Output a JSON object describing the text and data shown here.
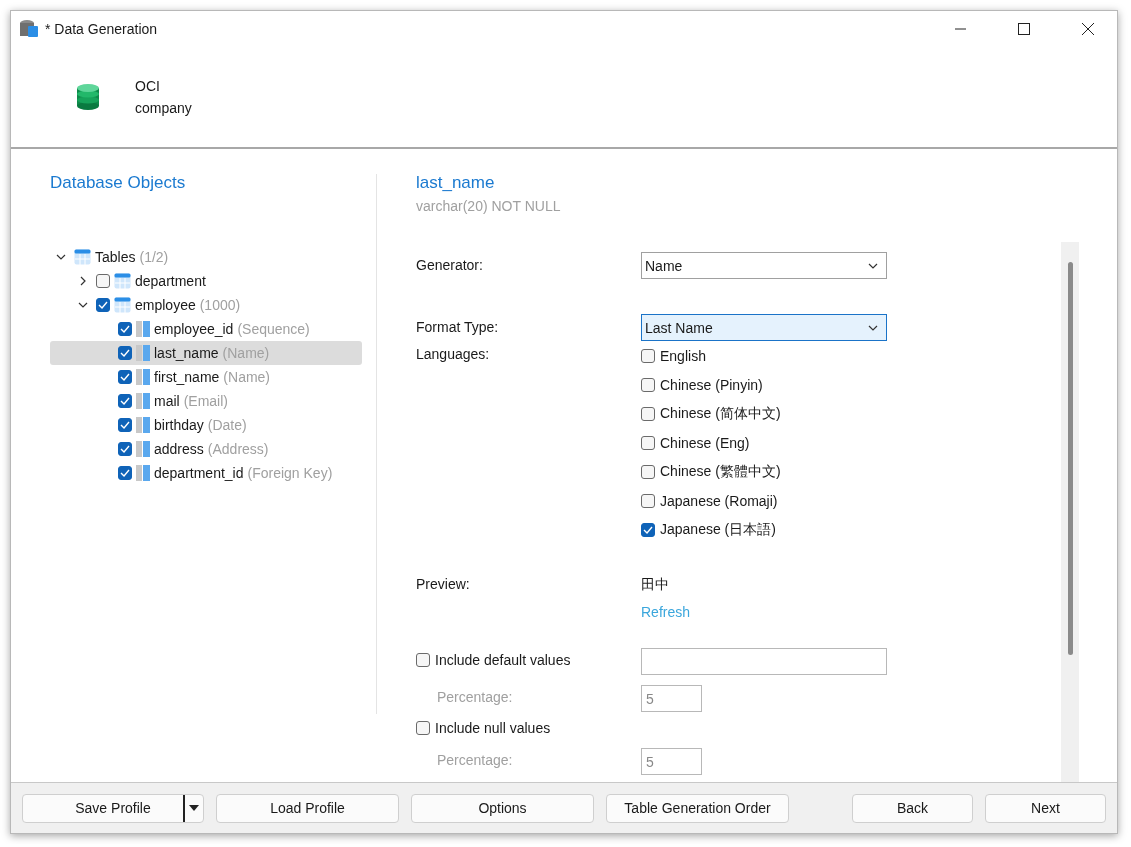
{
  "window": {
    "title": "* Data Generation"
  },
  "connection": {
    "name": "OCI",
    "database": "company"
  },
  "objects_panel": {
    "title": "Database Objects",
    "tree": [
      {
        "kind": "group",
        "label": "Tables",
        "note": "(1/2)",
        "expanded": true,
        "children": [
          {
            "kind": "table",
            "label": "department",
            "checked": false,
            "expanded": false
          },
          {
            "kind": "table",
            "label": "employee",
            "note": "(1000)",
            "checked": true,
            "expanded": true,
            "children": [
              {
                "kind": "column",
                "label": "employee_id",
                "note": "(Sequence)",
                "checked": true,
                "selected": false
              },
              {
                "kind": "column",
                "label": "last_name",
                "note": "(Name)",
                "checked": true,
                "selected": true
              },
              {
                "kind": "column",
                "label": "first_name",
                "note": "(Name)",
                "checked": true,
                "selected": false
              },
              {
                "kind": "column",
                "label": "mail",
                "note": "(Email)",
                "checked": true,
                "selected": false
              },
              {
                "kind": "column",
                "label": "birthday",
                "note": "(Date)",
                "checked": true,
                "selected": false
              },
              {
                "kind": "column",
                "label": "address",
                "note": "(Address)",
                "checked": true,
                "selected": false
              },
              {
                "kind": "column",
                "label": "department_id",
                "note": "(Foreign Key)",
                "checked": true,
                "selected": false
              }
            ]
          }
        ]
      }
    ]
  },
  "field": {
    "name": "last_name",
    "type": "varchar(20) NOT NULL"
  },
  "form": {
    "generator": {
      "label": "Generator:",
      "value": "Name",
      "focused": false
    },
    "format_type": {
      "label": "Format Type:",
      "value": "Last Name",
      "focused": true
    },
    "languages": {
      "label": "Languages:",
      "options": [
        {
          "label": "English",
          "checked": false
        },
        {
          "label": "Chinese (Pinyin)",
          "checked": false
        },
        {
          "label": "Chinese (简体中文)",
          "checked": false
        },
        {
          "label": "Chinese (Eng)",
          "checked": false
        },
        {
          "label": "Chinese (繁體中文)",
          "checked": false
        },
        {
          "label": "Japanese (Romaji)",
          "checked": false
        },
        {
          "label": "Japanese (日本語)",
          "checked": true
        }
      ]
    },
    "preview": {
      "label": "Preview:",
      "value": "田中",
      "link": "Refresh"
    },
    "options": [
      {
        "label": "Include default values",
        "checked": false,
        "has_value_field": true,
        "percentage_label": "Percentage:",
        "percentage": "5"
      },
      {
        "label": "Include null values",
        "checked": false,
        "has_value_field": false,
        "percentage_label": "Percentage:",
        "percentage": "5"
      }
    ]
  },
  "buttons_left": [
    {
      "kind": "split",
      "label": "Save Profile"
    },
    {
      "kind": "plain",
      "label": "Load Profile"
    },
    {
      "kind": "plain",
      "label": "Options"
    },
    {
      "kind": "plain",
      "label": "Table Generation Order"
    }
  ],
  "buttons_right": [
    {
      "kind": "plain",
      "label": "Back"
    },
    {
      "kind": "plain",
      "label": "Next"
    }
  ]
}
